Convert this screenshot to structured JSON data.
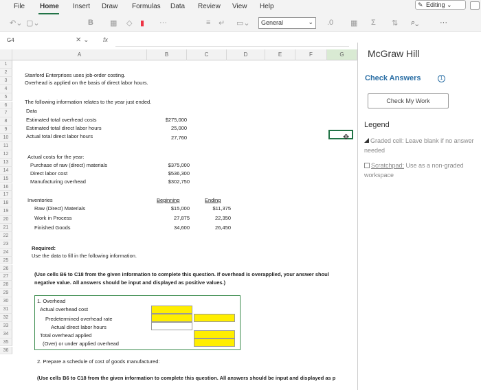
{
  "ribbon": {
    "tabs": [
      "File",
      "Home",
      "Insert",
      "Draw",
      "Formulas",
      "Data",
      "Review",
      "View",
      "Help"
    ],
    "editing_label": "Editing",
    "number_format": "General"
  },
  "formula_bar": {
    "name_box": "G4",
    "fx": "fx"
  },
  "columns": [
    "A",
    "B",
    "C",
    "D",
    "E",
    "F",
    "G"
  ],
  "rows": [
    "1",
    "2",
    "3",
    "4",
    "5",
    "6",
    "7",
    "8",
    "9",
    "10",
    "11",
    "12",
    "13",
    "14",
    "15",
    "16",
    "17",
    "18",
    "19",
    "20",
    "21",
    "22",
    "23",
    "24",
    "25",
    "26",
    "27",
    "28",
    "29",
    "30",
    "31",
    "32",
    "33",
    "34",
    "35",
    "36"
  ],
  "sheet": {
    "r2": "Stanford Enterprises uses job-order costing.",
    "r3": "Overhead is applied on the basis of direct labor hours.",
    "r5": "The following information relates to the year just ended.",
    "r6": "Data",
    "r7": {
      "label": "Estimated total overhead costs",
      "value": "$275,000"
    },
    "r8": {
      "label": "Estimated total direct labor hours",
      "value": "25,000"
    },
    "r9": {
      "label": "Actual total direct labor hours",
      "value": "27,760"
    },
    "r11": "Actual costs for the year:",
    "r12": {
      "label": "Purchase of raw (direct) materials",
      "value": "$375,000"
    },
    "r13": {
      "label": "Direct labor cost",
      "value": "$536,300"
    },
    "r14": {
      "label": "Manufacturing overhead",
      "value": "$302,750"
    },
    "inventories": {
      "label": "Inventories",
      "beginning": "Beginning",
      "ending": "Ending",
      "rows": [
        {
          "label": "Raw (Direct) Materials",
          "beginning": "$15,000",
          "ending": "$11,375"
        },
        {
          "label": "Work in Process",
          "beginning": "27,875",
          "ending": "22,350"
        },
        {
          "label": "Finished Goods",
          "beginning": "34,600",
          "ending": "26,450"
        }
      ]
    },
    "r21": "Required:",
    "r22": "Use the data to fill in the following information.",
    "r24a": "(Use cells B6 to C18 from the given information to complete this question. If overhead is overapplied, your answer shoul",
    "r24b": "negative value. All answers should be input and displayed as positive values.)",
    "r26": "1. Overhead",
    "r27": "Actual overhead cost",
    "r28": "Predetermined overhead rate",
    "r29": "Actual direct labor hours",
    "r30": "Total overhead applied",
    "r31": "(Over) or under applied overhead",
    "r33": "2. Prepare a schedule of cost of goods manufactured:",
    "r35": "(Use cells B6 to C18 from the given information to complete this question. All answers should be input and displayed as p"
  },
  "panel": {
    "title": "McGraw Hill",
    "check_answers": "Check Answers",
    "info": "1",
    "check_work": "Check My Work",
    "legend": "Legend",
    "graded": "Graded cell: Leave blank if no answer needed",
    "scratchpad": "Scratchpad:",
    "scratchpad_rest": " Use as a non-graded workspace"
  }
}
